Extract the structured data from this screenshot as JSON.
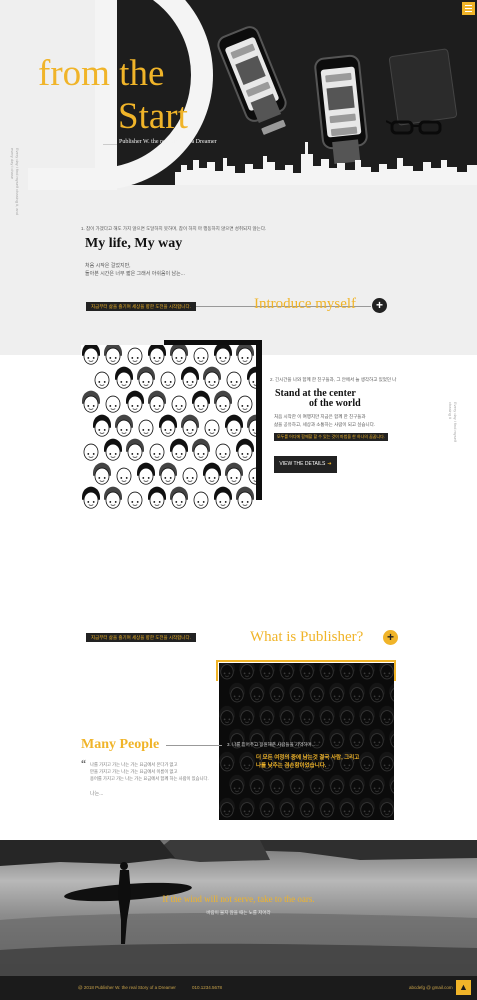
{
  "hero": {
    "title_line1": "from the",
    "title_line2": "Start",
    "subtitle": "Publisher W. the real Story of a Dreamer",
    "side_text": "Every day i find myself chasing it, and every day i chase",
    "menu_icon": "hamburger-icon"
  },
  "intro": {
    "number_text": "1. 참이 가겠다고 해도 가지 않으면 도달하지 못하며, 참이 하지 마 행동하지 않으면 성취되지 않는다.",
    "title": "My life, My way",
    "para_line1": "처음 시작은 걸었지만,",
    "para_line2": "돌아본 시간은 너무 짧은 그래서 아쉬움이 남는...",
    "tag": "지금부터 삶을 즐기며 세상을 향한 도전을 시작합니다.",
    "link": "Introduce myself",
    "plus_icon": "plus-icon"
  },
  "center": {
    "number_text": "2. 긴시간을 나와 함께 한 친구들과, 그 안에서 늘 생각하고 있었던 나",
    "title_line1": "Stand at the center",
    "title_line2": "of the world",
    "para_line1": "처음 시작한 이 여행지만 지금은 함께 한 친구들과",
    "para_line2": "삶을 공유하고, 세상과 소통하는 사람이 되고 싶습니다.",
    "tag": "모두를 어디에 함께할 할 수 있는 것이 마법을 한 하나의 꿈꿉니다.",
    "button": "VIEW THE DETAILS",
    "button_icon": "arrow-right-icon",
    "side_text": "Every day i find myself chasing it"
  },
  "publisher": {
    "tag": "지금부터 삶을 즐기며 세상을 향한 도전을 시작합니다.",
    "link": "What is Publisher?",
    "plus_icon": "plus-icon",
    "box_number": "3. 나를 믿어주고 응원해준 사람들을 기억하며...",
    "box_quote1": "더 모든 여정의 중에 남는것 결국 사람, 그리고",
    "box_quote2": "나를 낮추는 겸손함이었습니다.",
    "many_title": "Many People",
    "many_lines": [
      "나를 가지고 가는 나는 가는 요금에서 온다가 없고",
      "만을 가지고 가는 나는 가는 요금에서 이름이 없고",
      "용어를 가지고 가는 나는 가는 요금에서 함께 하는 사람이 있습니다."
    ],
    "many_end": "나는..."
  },
  "surf": {
    "quote": "If the wind will not serve, take to the oars.",
    "sub": "바람이 불지 않을 때는 노를 저어라"
  },
  "footer": {
    "copyright": "@ 2018 Publisher W. the real Story of a Dreamer",
    "phone": "010.1234.5678",
    "email": "abcdefg @ gmail.com",
    "top_icon": "arrow-up-icon"
  },
  "colors": {
    "accent": "#f0b429",
    "dark": "#1d1d1d",
    "light_bg": "#efefef"
  }
}
